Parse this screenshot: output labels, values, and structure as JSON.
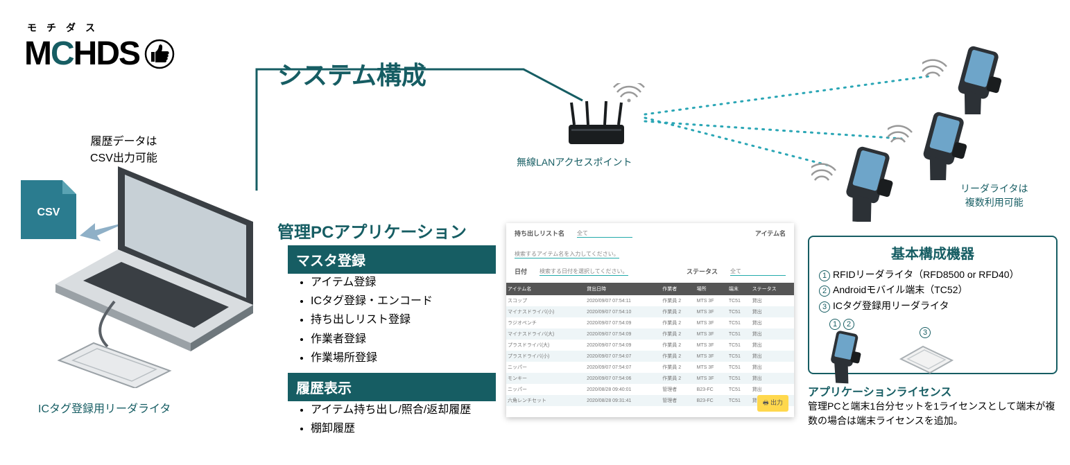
{
  "logo": {
    "kana": "モチダス",
    "main_pre": "M",
    "main_c": "C",
    "main_post": "HDS"
  },
  "title": "システム構成",
  "csv": {
    "note_l1": "履歴データは",
    "note_l2": "CSV出力可能",
    "badge": "CSV"
  },
  "laptop_label": "ICタグ登録用リーダライタ",
  "app": {
    "title": "管理PCアプリケーション",
    "section_master": "マスタ登録",
    "master_items": [
      "アイテム登録",
      "ICタグ登録・エンコード",
      "持ち出しリスト登録",
      "作業者登録",
      "作業場所登録"
    ],
    "section_history": "履歴表示",
    "history_items": [
      "アイテム持ち出し/照合/返却履歴",
      "棚卸履歴"
    ]
  },
  "shot": {
    "filter_labels": {
      "list": "持ち出しリスト名",
      "all": "全て",
      "date": "日付",
      "date_ph": "検索する日付を選択してください。",
      "item": "アイテム名",
      "item_ph": "検索するアイテム名を入力してください。",
      "status": "ステータス"
    },
    "columns": [
      "アイテム名",
      "貸出日時",
      "作業者",
      "場所",
      "端末",
      "ステータス"
    ],
    "rows": [
      [
        "スコップ",
        "2020/09/07 07:54:11",
        "作業員 2",
        "MTS 3F",
        "TC51",
        "貸出"
      ],
      [
        "マイナスドライバ(小)",
        "2020/09/07 07:54:10",
        "作業員 2",
        "MTS 3F",
        "TC51",
        "貸出"
      ],
      [
        "ラジオペンチ",
        "2020/09/07 07:54:09",
        "作業員 2",
        "MTS 3F",
        "TC51",
        "貸出"
      ],
      [
        "マイナスドライバ(大)",
        "2020/09/07 07:54:09",
        "作業員 2",
        "MTS 3F",
        "TC51",
        "貸出"
      ],
      [
        "プラスドライバ(大)",
        "2020/09/07 07:54:09",
        "作業員 2",
        "MTS 3F",
        "TC51",
        "貸出"
      ],
      [
        "プラスドライバ(小)",
        "2020/09/07 07:54:07",
        "作業員 2",
        "MTS 3F",
        "TC51",
        "貸出"
      ],
      [
        "ニッパー",
        "2020/09/07 07:54:07",
        "作業員 2",
        "MTS 3F",
        "TC51",
        "貸出"
      ],
      [
        "モンキー",
        "2020/09/07 07:54:06",
        "作業員 2",
        "MTS 3F",
        "TC51",
        "貸出"
      ],
      [
        "ニッパー",
        "2020/08/28 09:40:01",
        "管理者",
        "B23-FC",
        "TC51",
        "貸出"
      ],
      [
        "六角レンチセット",
        "2020/08/28 09:31:41",
        "管理者",
        "B23-FC",
        "TC51",
        "貸出"
      ]
    ],
    "out_btn": "出力"
  },
  "ap_label": "無線LANアクセスポイント",
  "rw": {
    "l1": "リーダライタは",
    "l2": "複数利用可能"
  },
  "equip": {
    "title": "基本構成機器",
    "items": [
      "RFIDリーダライタ（RFD8500 or RFD40）",
      "Androidモバイル端末（TC52）",
      "ICタグ登録用リーダライタ"
    ],
    "circles": [
      "1",
      "2",
      "3",
      "1",
      "2",
      "3"
    ]
  },
  "license": {
    "title": "アプリケーションライセンス",
    "body": "管理PCと端末1台分セットを1ライセンスとして端末が複数の場合は端末ライセンスを追加。"
  }
}
